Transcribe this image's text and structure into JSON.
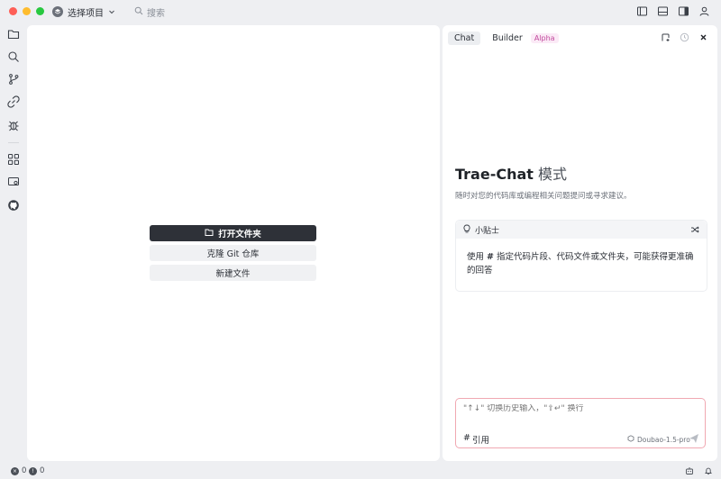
{
  "titlebar": {
    "traffic_colors": {
      "close": "#fe5f57",
      "minimize": "#febc2e",
      "maximize": "#28c840"
    },
    "project_selector": "选择项目",
    "search_placeholder": "搜索",
    "right_icons": [
      "sidebar-left-icon",
      "panel-bottom-icon",
      "sidebar-right-icon",
      "account-icon"
    ]
  },
  "activity_bar": {
    "items": [
      "explorer-icon",
      "search-icon",
      "source-control-icon",
      "extensions-link-icon",
      "debug-icon",
      "apps-icon",
      "remote-icon",
      "github-icon"
    ]
  },
  "editor": {
    "open_folder": "打开文件夹",
    "clone_repo": "克隆 Git 仓库",
    "new_file": "新建文件"
  },
  "chat": {
    "tabs": [
      {
        "label": "Chat",
        "active": true
      },
      {
        "label": "Builder",
        "badge": "Alpha"
      }
    ],
    "title_strong": "Trae-Chat",
    "title_mode": " 模式",
    "subtitle": "随时对您的代码库或编程相关问题提问或寻求建议。",
    "tips": {
      "heading": "小贴士",
      "body_prefix": "使用 ",
      "body_hash": "#",
      "body_rest": " 指定代码片段、代码文件或文件夹，可能获得更准确的回答"
    },
    "input": {
      "placeholder": "\"↑↓\" 切换历史输入，\"⇧↵\" 换行",
      "reference": "引用",
      "reference_hash": "#",
      "model": "Doubao-1.5-pro"
    }
  },
  "statusbar": {
    "errors": "0",
    "warnings": "0"
  },
  "colors": {
    "accent_dark": "#2e3138",
    "input_border": "#f0a8b2",
    "badge": "#c14a9d"
  }
}
